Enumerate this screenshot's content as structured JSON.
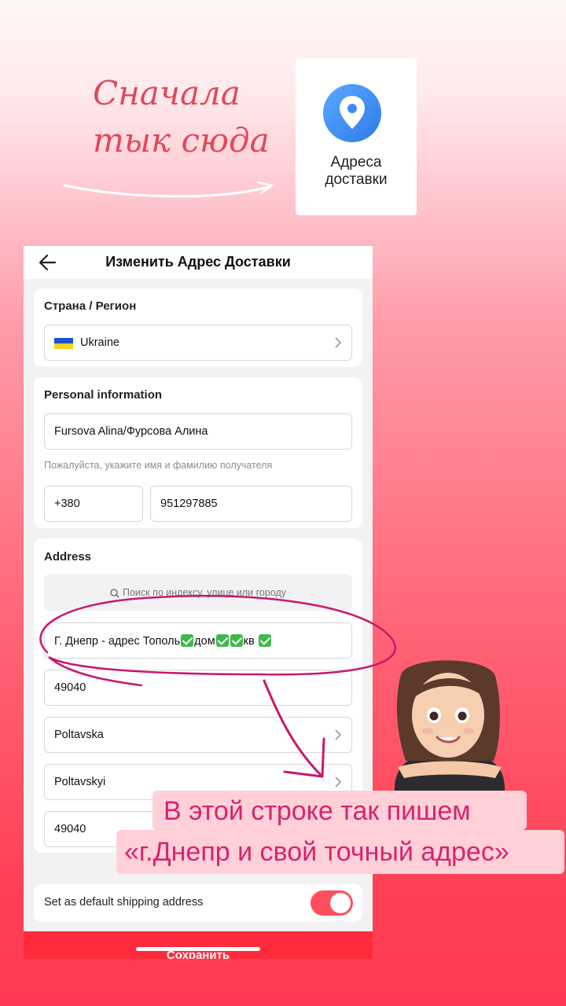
{
  "annotation": {
    "handwritten_line1": "Сначала",
    "handwritten_line2": "тык сюда",
    "caption_line1": "В этой строке так пишем",
    "caption_line2": "«г.Днепр и свой точный адрес»"
  },
  "tile": {
    "icon": "location-pin-icon",
    "label_line1": "Адреса",
    "label_line2": "доставки",
    "accent": "#3d8bf2"
  },
  "header": {
    "title": "Изменить Адрес Доставки",
    "back_icon": "back-arrow-icon"
  },
  "country": {
    "heading": "Страна / Регион",
    "value": "Ukraine",
    "flag_colors": [
      "#1b55c7",
      "#f7d11a"
    ]
  },
  "personal": {
    "heading": "Personal information",
    "name": "Fursova Alina/Фурсова Алина",
    "name_hint": "Пожалуйста, укажите имя и фамилию получателя",
    "phone_code": "+380",
    "phone_number": "951297885"
  },
  "address": {
    "heading": "Address",
    "search_placeholder": "Поиск по индексу, улице или городу",
    "street_part1": "Г. Днепр - адрес Тополь",
    "street_part2": "дом",
    "street_part3": "кв",
    "postcode": "49040",
    "region": "Poltavska",
    "district": "Poltavskyi",
    "zip": "49040"
  },
  "default_toggle": {
    "label": "Set as default shipping address",
    "on": true,
    "color": "#ff4e5b"
  },
  "save": {
    "label": "Сохранить",
    "color": "#ff2b3c"
  },
  "colors": {
    "annotation_red": "#e0485c",
    "circle_magenta": "#c8186e",
    "caption_text": "#d8246f"
  }
}
